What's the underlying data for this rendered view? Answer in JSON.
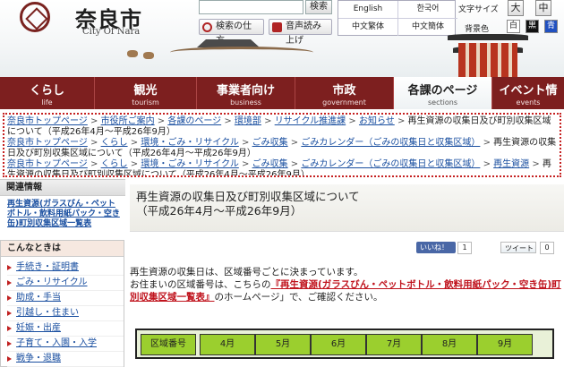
{
  "header": {
    "logo_title": "奈良市",
    "logo_sub": "City Of Nara",
    "search_button": "検索",
    "howto_button": "検索の仕方",
    "voice_button": "音声読み上げ",
    "languages": [
      "English",
      "한국어",
      "中文繁体",
      "中文簡体"
    ],
    "fontsize_label": "文字サイズ",
    "fontsize_buttons": [
      "大",
      "中"
    ],
    "bgcolor_label": "背景色",
    "bgcolor_buttons": [
      "白",
      "黒",
      "青"
    ]
  },
  "nav": [
    {
      "label": "くらし",
      "sub": "life"
    },
    {
      "label": "観光",
      "sub": "tourism"
    },
    {
      "label": "事業者向け",
      "sub": "business"
    },
    {
      "label": "市政",
      "sub": "government"
    },
    {
      "label": "各課のページ",
      "sub": "sections"
    },
    {
      "label": "イベント情",
      "sub": "events"
    }
  ],
  "breadcrumbs": [
    {
      "links": [
        "奈良市トップページ",
        "市役所ご案内",
        "各課のページ",
        "環境部",
        "リサイクル推進課",
        "お知らせ"
      ],
      "current": "再生資源の収集日及び町別収集区域について（平成26年4月〜平成26年9月）"
    },
    {
      "links": [
        "奈良市トップページ",
        "くらし",
        "環境・ごみ・リサイクル",
        "ごみ収集",
        "ごみカレンダー（ごみの収集日と収集区域）"
      ],
      "current": "再生資源の収集日及び町別収集区域について（平成26年4月〜平成26年9月）"
    },
    {
      "links": [
        "奈良市トップページ",
        "くらし",
        "環境・ごみ・リサイクル",
        "ごみ収集",
        "ごみカレンダー（ごみの収集日と収集区域）",
        "再生資源"
      ],
      "current": "再生資源の収集日及び町別収集区域について（平成26年4月〜平成26年9月）"
    }
  ],
  "sidebar": {
    "related_heading": "関連情報",
    "related_link": "再生資源(ガラスびん・ペットボトル・飲料用紙パック・空き缶)町別収集区域一覧表",
    "situations_heading": "こんなときは",
    "situations": [
      "手続き・証明書",
      "ごみ・リサイクル",
      "助成・手当",
      "引越し・住まい",
      "妊娠・出産",
      "子育て・入園・入学",
      "戦争・退職"
    ]
  },
  "main": {
    "title_line1": "再生資源の収集日及び町別収集区域について",
    "title_line2": "（平成26年4月〜平成26年9月）",
    "like_label": "いいね！",
    "like_count": "1",
    "tweet_label": "ツイート",
    "tweet_count": "0",
    "para1": "再生資源の収集日は、区域番号ごとに決まっています。",
    "para2_prefix": "お住まいの区域番号は、こちらの",
    "para2_link": "『再生資源(ガラスびん・ペットボトル・飲料用紙パック・空き缶)町別収集区域一覧表』",
    "para2_suffix": "のホームページ」で、ご確認ください。",
    "table_headers": [
      "区域番号",
      "4月",
      "5月",
      "6月",
      "7月",
      "8月",
      "9月"
    ]
  }
}
